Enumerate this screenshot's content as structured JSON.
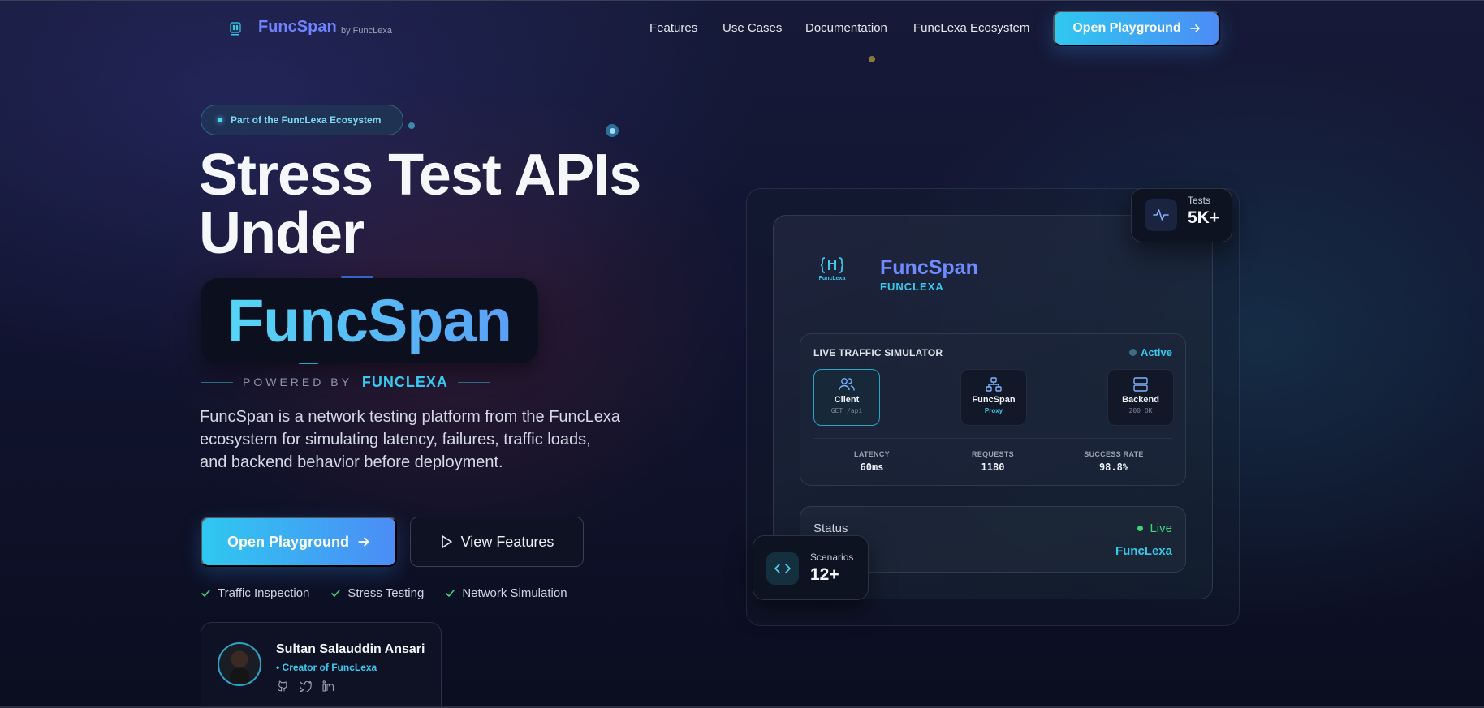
{
  "nav": {
    "brand": "FuncSpan",
    "brand_by": "by FuncLexa",
    "links": [
      "Features",
      "Use Cases",
      "Documentation",
      "FuncLexa Ecosystem"
    ],
    "cta": "Open Playground"
  },
  "hero": {
    "badge": "Part of the FuncLexa Ecosystem",
    "headline_line1": "Stress Test APIs",
    "headline_line2": "Under",
    "highlight": "FuncSpan",
    "powered_by": "POWERED BY",
    "powered_brand": "FUNCLEXA",
    "description": "FuncSpan is a network testing platform from the FuncLexa ecosystem for simulating latency, failures, traffic loads, and backend behavior before deployment.",
    "primary_cta": "Open Playground",
    "secondary_cta": "View Features",
    "features": [
      "Traffic Inspection",
      "Stress Testing",
      "Network Simulation"
    ]
  },
  "creator": {
    "name": "Sultan Salauddin Ansari",
    "role": "• Creator of FuncLexa",
    "socials": [
      "github-icon",
      "twitter-icon",
      "linkedin-icon"
    ]
  },
  "panel": {
    "title": "FuncSpan",
    "subtitle": "FUNCLEXA",
    "logo_text": "FuncLexa",
    "simulator": {
      "title": "LIVE TRAFFIC SIMULATOR",
      "status": "Active",
      "nodes": [
        {
          "name": "Client",
          "sub": "GET /api"
        },
        {
          "name": "FuncSpan",
          "sub": "Proxy"
        },
        {
          "name": "Backend",
          "sub": "200 OK"
        }
      ],
      "metrics": [
        {
          "label": "LATENCY",
          "value": "60ms"
        },
        {
          "label": "REQUESTS",
          "value": "1180"
        },
        {
          "label": "SUCCESS RATE",
          "value": "98.8%"
        }
      ]
    },
    "status": {
      "label": "Status",
      "value": "Live",
      "ref": "FuncLexa"
    }
  },
  "floats": {
    "tests_label": "Tests",
    "tests_value": "5K+",
    "scenarios_label": "Scenarios",
    "scenarios_value": "12+"
  },
  "colors": {
    "accent_cyan": "#38c9ee",
    "accent_blue": "#6e83ff",
    "live_green": "#3bd57c"
  }
}
